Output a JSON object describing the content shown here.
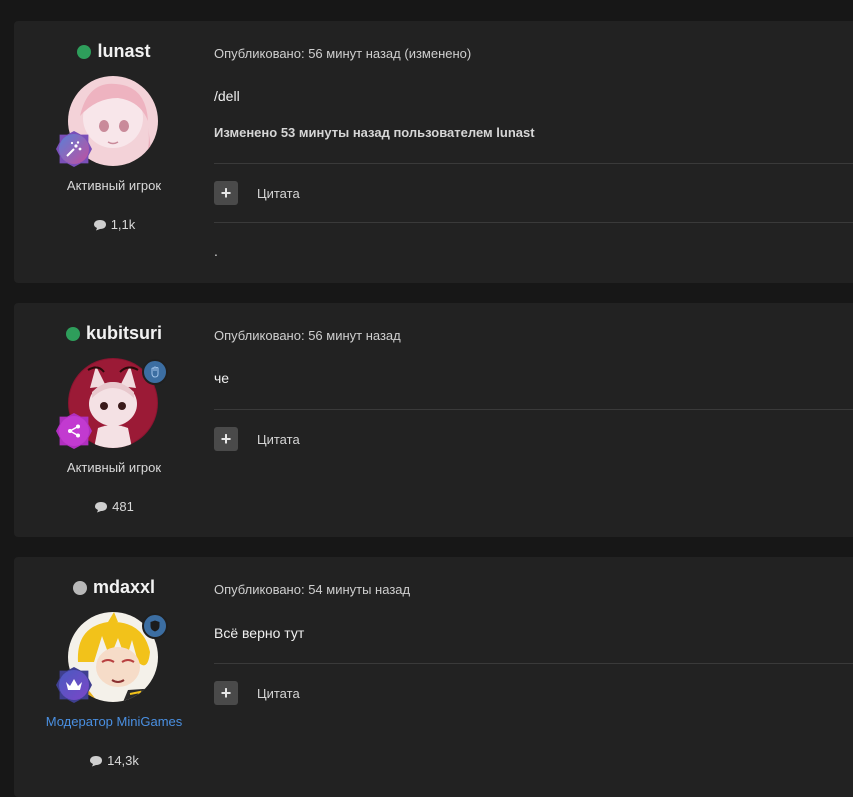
{
  "posts": [
    {
      "author": "lunast",
      "status_color": "#2e9e5b",
      "role": "Активный игрок",
      "post_count": "1,1k",
      "meta": "Опубликовано: 56 минут назад (изменено)",
      "body": "/dell",
      "edit_note": "Изменено 53 минуты назад пользователем lunast",
      "quote_label": "Цитата",
      "signature": "."
    },
    {
      "author": "kubitsuri",
      "status_color": "#2e9e5b",
      "role": "Активный игрок",
      "post_count": "481",
      "meta": "Опубликовано: 56 минут назад",
      "body": "че",
      "quote_label": "Цитата"
    },
    {
      "author": "mdaxxl",
      "status_color": "#b9b9b9",
      "role": "Модератор MiniGames",
      "post_count": "14,3k",
      "meta": "Опубликовано: 54 минуты назад",
      "body": "Всё верно тут",
      "quote_label": "Цитата"
    }
  ],
  "colors": {
    "background": "#171717",
    "panel": "#222222",
    "online": "#2e9e5b",
    "offline": "#b9b9b9",
    "moderator": "#4a90e2"
  },
  "icons": {
    "rank_badge_1": "spark-rank-icon",
    "rank_badge_2": "share-rank-icon",
    "rank_badge_3": "crown-rank-icon",
    "group_badge_2": "hand-icon",
    "group_badge_3": "shield-icon",
    "posts": "speech-bubble-icon",
    "quote": "plus-icon"
  }
}
